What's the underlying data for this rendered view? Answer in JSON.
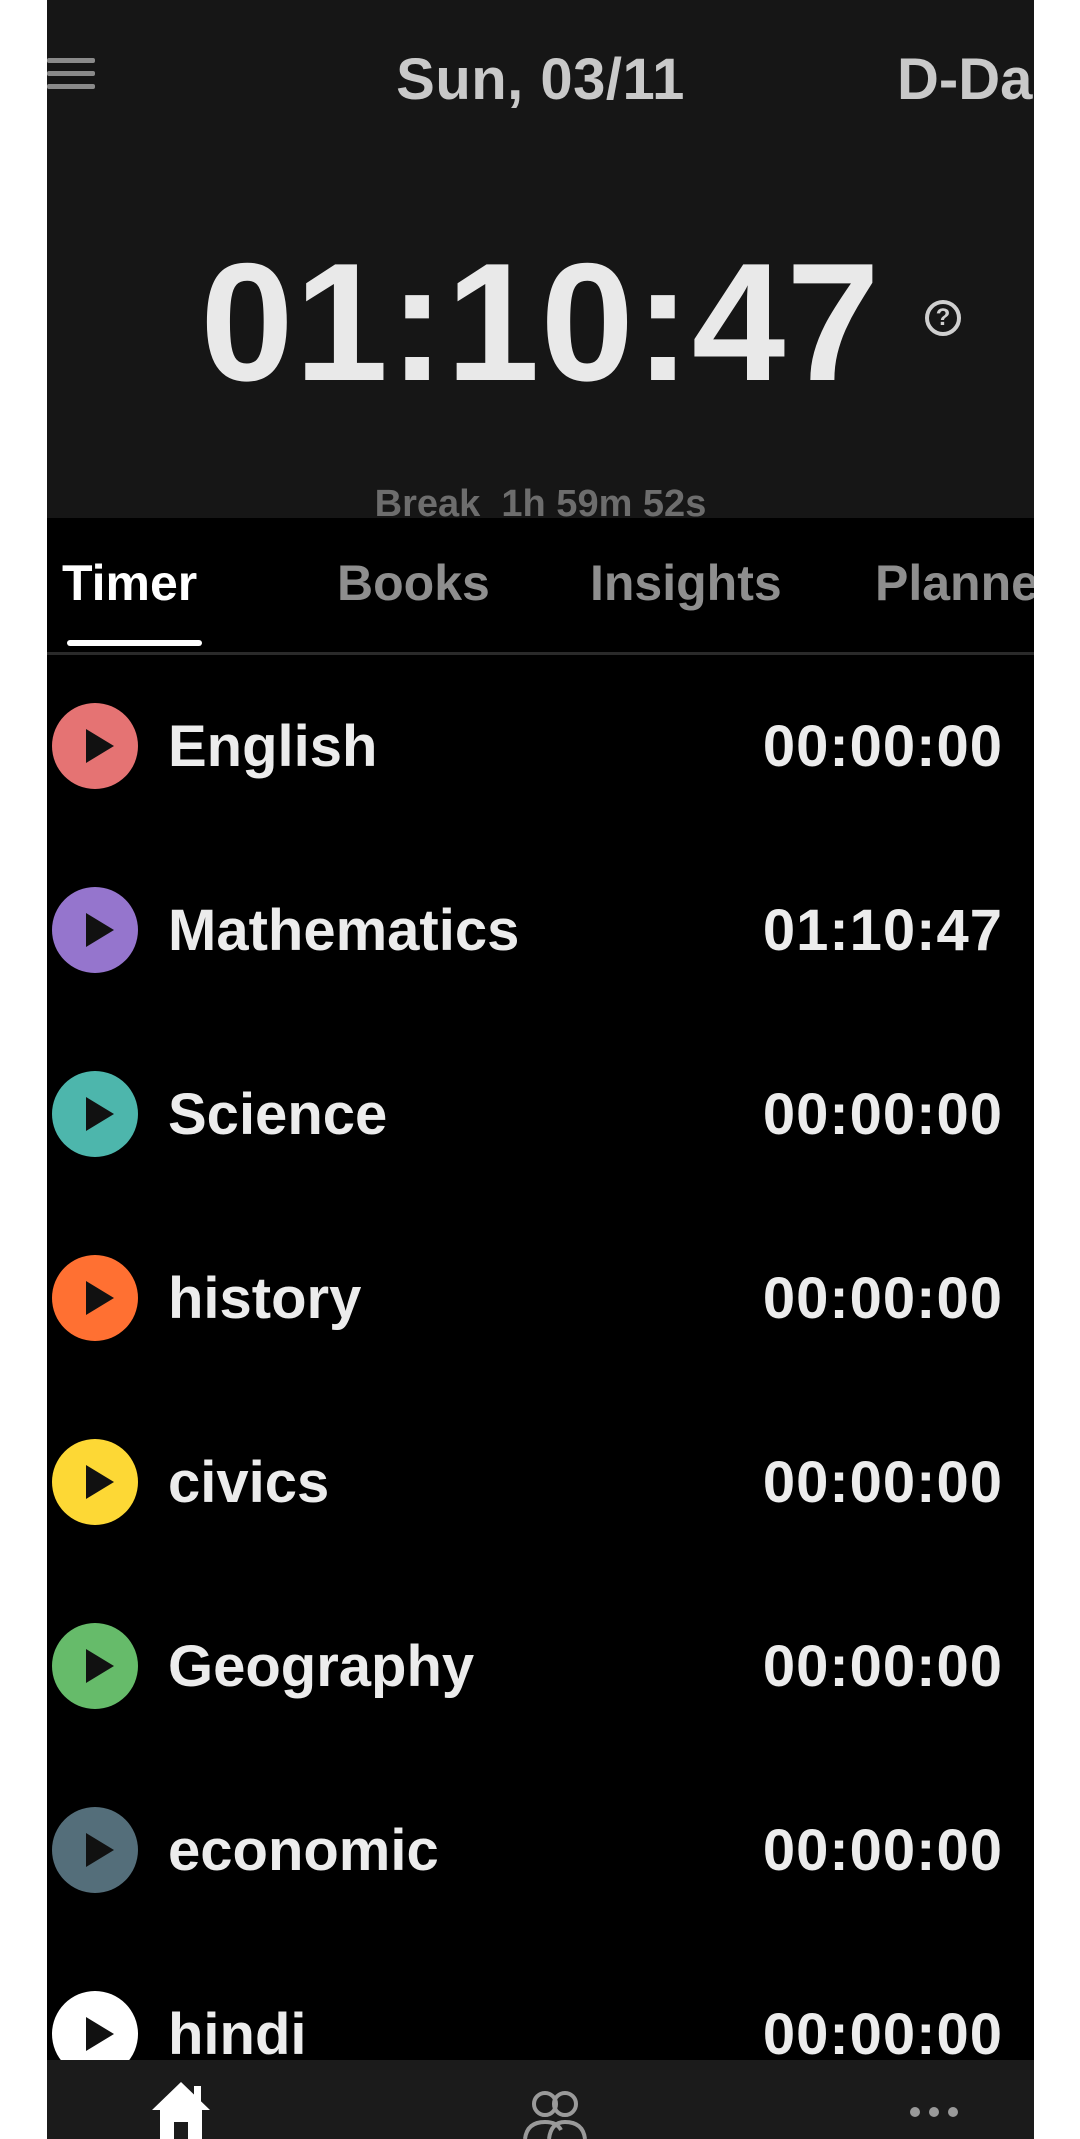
{
  "header": {
    "date": "Sun, 03/11",
    "dday": "D-Da",
    "timer": "01:10:47",
    "help": "?",
    "break_label": "Break  1h 59m 52s"
  },
  "tabs": [
    {
      "label": "Timer",
      "active": true
    },
    {
      "label": "Books",
      "active": false
    },
    {
      "label": "Insights",
      "active": false
    },
    {
      "label": "Planne",
      "active": false
    }
  ],
  "subjects": [
    {
      "name": "English",
      "time": "00:00:00",
      "color": "#e57373"
    },
    {
      "name": "Mathematics",
      "time": "01:10:47",
      "color": "#9575cd"
    },
    {
      "name": "Science",
      "time": "00:00:00",
      "color": "#4db6ac"
    },
    {
      "name": "history",
      "time": "00:00:00",
      "color": "#ff7032"
    },
    {
      "name": "civics",
      "time": "00:00:00",
      "color": "#fdd835"
    },
    {
      "name": "Geography",
      "time": "00:00:00",
      "color": "#66bb6a"
    },
    {
      "name": "economic",
      "time": "00:00:00",
      "color": "#546e7a"
    },
    {
      "name": "hindi",
      "time": "00:00:00",
      "color": "#ffffff"
    }
  ],
  "bottom_nav": [
    {
      "icon": "home-icon"
    },
    {
      "icon": "group-icon"
    },
    {
      "icon": "more-icon"
    }
  ]
}
